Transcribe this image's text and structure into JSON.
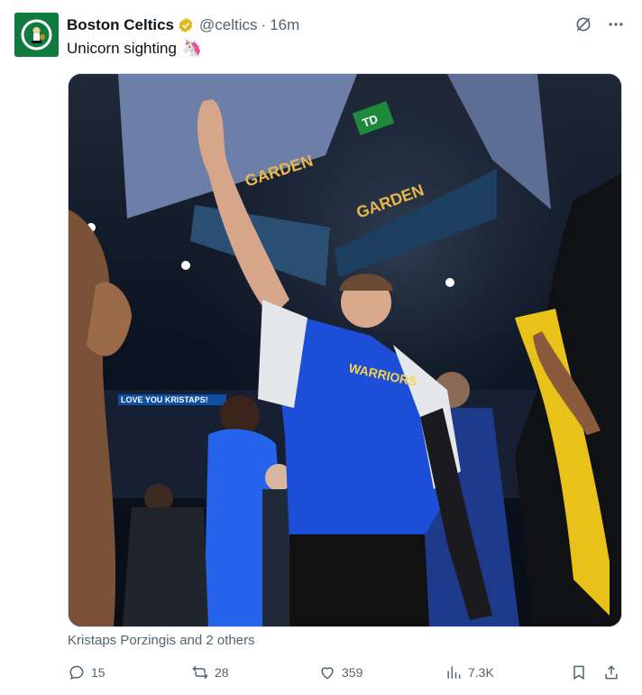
{
  "tweet": {
    "display_name": "Boston Celtics",
    "handle": "@celtics",
    "separator": "·",
    "time": "16m",
    "text": "Unicorn sighting",
    "emoji": "🦄",
    "tagged": "Kristaps Porzingis and 2 others"
  },
  "media": {
    "scoreboard_text": "GARDEN",
    "sponsor_text": "TD",
    "jersey_text": "WARRIORS",
    "side_banner": "LOVE YOU KRISTAPS!"
  },
  "actions": {
    "replies": "15",
    "reposts": "28",
    "likes": "359",
    "views": "7.3K"
  },
  "icons": {
    "verified": "verified-badge-icon",
    "grok": "grok-icon",
    "more": "more-icon",
    "reply": "reply-icon",
    "repost": "repost-icon",
    "like": "like-icon",
    "views": "views-icon",
    "bookmark": "bookmark-icon",
    "share": "share-icon"
  },
  "colors": {
    "secondary_text": "#536471",
    "verified_gold": "#e2b719",
    "celtics_green": "#0f7a3e",
    "warriors_blue": "#1d4ed8"
  }
}
